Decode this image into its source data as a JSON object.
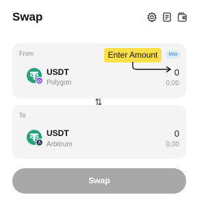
{
  "header": {
    "title": "Swap",
    "icons": [
      "gear-icon",
      "history-icon",
      "wallet-icon"
    ]
  },
  "from_section": {
    "label": "From",
    "max_label": "Max",
    "token": "USDT",
    "network": "Polygon",
    "amount": "0",
    "usd_value": "0.00"
  },
  "to_section": {
    "label": "To",
    "token": "USDT",
    "network": "Arbitrum",
    "amount": "0",
    "usd_value": "0.00"
  },
  "annotation": {
    "text": "Enter Amount",
    "color": "#fde047"
  },
  "swap_button": {
    "label": "Swap",
    "color": "#a8a8a8"
  },
  "colors": {
    "tether_green": "#26a17b",
    "polygon_purple": "#8247e5",
    "arbitrum_navy": "#2d374b",
    "max_badge_blue": "#3b82f6"
  }
}
